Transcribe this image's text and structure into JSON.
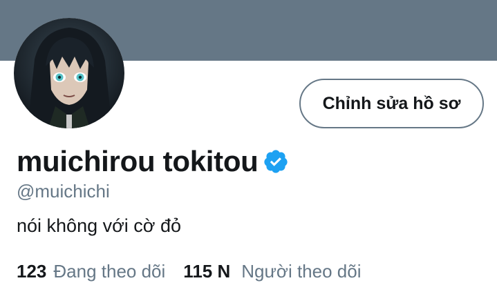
{
  "profile": {
    "display_name": "muichirou tokitou",
    "handle": "@muichichi",
    "bio": "nói không với cờ đỏ",
    "verified": true,
    "avatar_icon": "anime-avatar-image"
  },
  "actions": {
    "edit_profile_label": "Chỉnh sửa hồ sơ"
  },
  "stats": {
    "following_count": "123",
    "following_label": "Đang theo dõi",
    "followers_count": "115 N",
    "followers_label": "Người theo dõi"
  },
  "colors": {
    "banner": "#657786",
    "verified": "#1da1f2",
    "text_primary": "#14171a",
    "text_secondary": "#657786"
  }
}
